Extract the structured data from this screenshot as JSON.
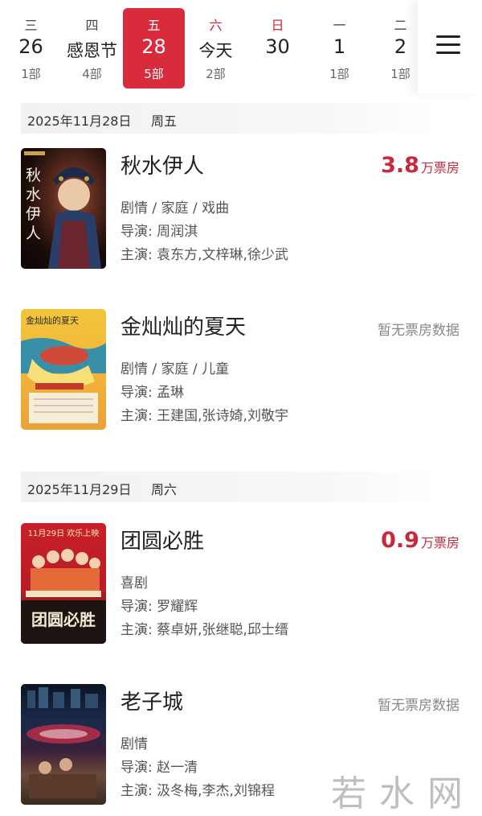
{
  "date_strip": {
    "days": [
      {
        "weekday": "三",
        "label": "26",
        "count": "1部"
      },
      {
        "weekday": "四",
        "label": "感恩节",
        "count": "4部"
      },
      {
        "weekday": "五",
        "label": "28",
        "count": "5部"
      },
      {
        "weekday": "六",
        "label": "今天",
        "count": "2部"
      },
      {
        "weekday": "日",
        "label": "30",
        "count": ""
      },
      {
        "weekday": "一",
        "label": "1",
        "count": "1部"
      },
      {
        "weekday": "二",
        "label": "2",
        "count": "1部"
      }
    ]
  },
  "sections": [
    {
      "date": "2025年11月28日",
      "weekday": "周五",
      "movies": [
        {
          "title": "秋水伊人",
          "box_value": "3.8",
          "box_unit": "万票房",
          "no_box": "",
          "genres": "剧情 / 家庭 / 戏曲",
          "director": "导演: 周润淇",
          "cast": "主演: 袁东方,文梓琳,徐少武",
          "poster_text": "秋水伊人"
        },
        {
          "title": "金灿灿的夏天",
          "box_value": "",
          "box_unit": "",
          "no_box": "暂无票房数据",
          "genres": "剧情 / 家庭 / 儿童",
          "director": "导演: 孟琳",
          "cast": "主演: 王建国,张诗婍,刘敬宇",
          "poster_text": "金灿灿的夏天"
        }
      ]
    },
    {
      "date": "2025年11月29日",
      "weekday": "周六",
      "movies": [
        {
          "title": "团圆必胜",
          "box_value": "0.9",
          "box_unit": "万票房",
          "no_box": "",
          "genres": "喜剧",
          "director": "导演: 罗耀辉",
          "cast": "主演: 蔡卓妍,张继聪,邱士缙",
          "poster_text": "团圆必胜",
          "poster_top": "11月29日 欢乐上映"
        },
        {
          "title": "老子城",
          "box_value": "",
          "box_unit": "",
          "no_box": "暂无票房数据",
          "genres": "剧情",
          "director": "导演: 赵一清",
          "cast": "主演: 汲冬梅,李杰,刘锦程",
          "poster_text": ""
        }
      ]
    }
  ],
  "watermark": "若水网",
  "colors": {
    "accent": "#d82b3b",
    "box_office": "#c8283a"
  }
}
